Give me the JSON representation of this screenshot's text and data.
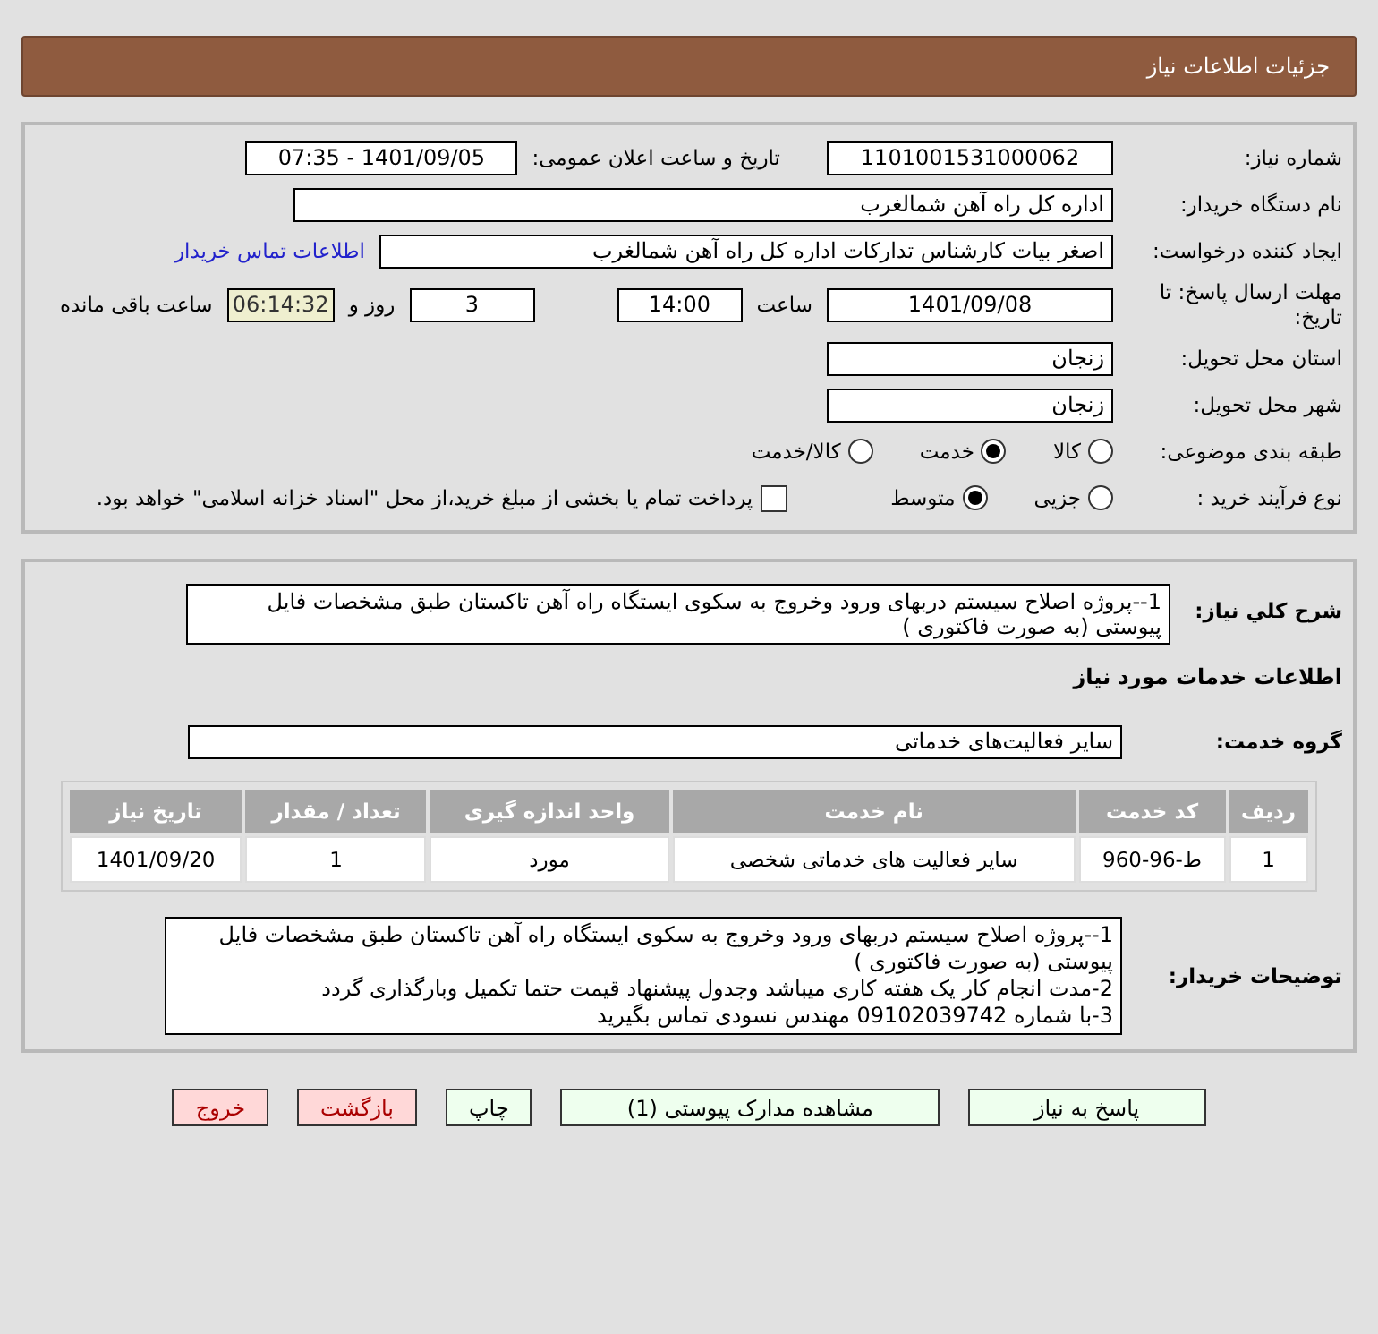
{
  "header": {
    "title": "جزئیات اطلاعات نیاز"
  },
  "need_number": {
    "label": "شماره نیاز:",
    "value": "1101001531000062"
  },
  "announce": {
    "label": "تاریخ و ساعت اعلان عمومی:",
    "value": "1401/09/05 - 07:35"
  },
  "buyer_org": {
    "label": "نام دستگاه خریدار:",
    "value": "اداره کل راه آهن شمالغرب"
  },
  "requester": {
    "label": "ایجاد کننده درخواست:",
    "value": "اصغر بیات کارشناس تدارکات اداره کل راه آهن شمالغرب",
    "link": "اطلاعات تماس خریدار"
  },
  "deadline": {
    "label": "مهلت ارسال پاسخ: تا تاریخ:",
    "date": "1401/09/08",
    "time_label": "ساعت",
    "time": "14:00",
    "days": "3",
    "days_label": "روز و",
    "remaining": "06:14:32",
    "remaining_label": "ساعت باقی مانده"
  },
  "province": {
    "label": "استان محل تحویل:",
    "value": "زنجان"
  },
  "city": {
    "label": "شهر محل تحویل:",
    "value": "زنجان"
  },
  "category": {
    "label": "طبقه بندی موضوعی:",
    "options": [
      {
        "label": "کالا",
        "selected": false
      },
      {
        "label": "خدمت",
        "selected": true
      },
      {
        "label": "کالا/خدمت",
        "selected": false
      }
    ]
  },
  "process": {
    "label": "نوع فرآیند خرید :",
    "options": [
      {
        "label": "جزیی",
        "selected": false
      },
      {
        "label": "متوسط",
        "selected": true
      }
    ],
    "payment": {
      "checked": false,
      "text": "پرداخت تمام یا بخشی از مبلغ خرید،از محل \"اسناد خزانه اسلامی\" خواهد بود."
    }
  },
  "summary": {
    "label": "شرح كلي نياز:",
    "value": "1--پروژه اصلاح سیستم دربهای ورود وخروج به سکوی ایستگاه راه آهن تاکستان طبق مشخصات فایل پیوستی (به صورت فاکتوری )"
  },
  "services_title": "اطلاعات خدمات مورد نیاز",
  "service_group": {
    "label": "گروه خدمت:",
    "value": "سایر فعالیت‌های خدماتی"
  },
  "table": {
    "columns": [
      "ردیف",
      "کد خدمت",
      "نام خدمت",
      "واحد اندازه گیری",
      "تعداد / مقدار",
      "تاریخ نیاز"
    ],
    "rows": [
      [
        "1",
        "ط-96-960",
        "سایر فعالیت های خدماتی شخصی",
        "مورد",
        "1",
        "1401/09/20"
      ]
    ]
  },
  "buyer_notes": {
    "label": "توضیحات خریدار:",
    "lines": [
      "1--پروژه اصلاح سیستم دربهای ورود وخروج به سکوی ایستگاه راه آهن تاکستان طبق مشخصات فایل پیوستی (به صورت فاکتوری )",
      "2-مدت انجام کار یک هفته کاری میباشد وجدول پیشنهاد قیمت حتما تکمیل وبارگذاری گردد",
      "3-با شماره 09102039742 مهندس نسودی تماس بگیرید"
    ]
  },
  "buttons": [
    {
      "label": "پاسخ به نیاز",
      "kind": "action"
    },
    {
      "label": "مشاهده مدارک پیوستی (1)",
      "kind": "action"
    },
    {
      "label": "چاپ",
      "kind": "action"
    },
    {
      "label": "بازگشت",
      "kind": "exit"
    },
    {
      "label": "خروج",
      "kind": "exit"
    }
  ]
}
